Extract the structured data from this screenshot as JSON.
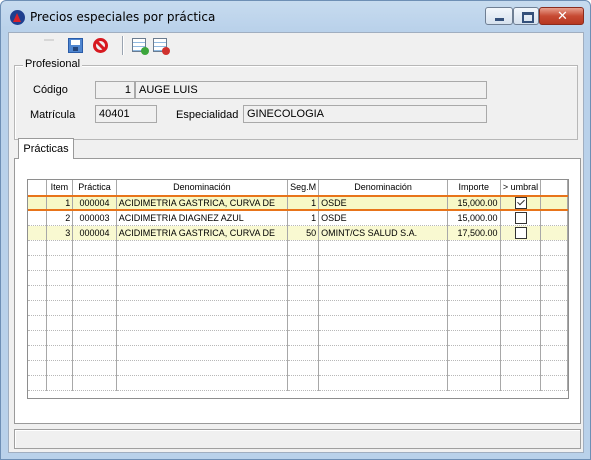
{
  "window": {
    "title": "Precios especiales por práctica"
  },
  "toolbar": {
    "icons": [
      "new-icon",
      "save-icon",
      "cancel-icon",
      "add-row-icon",
      "delete-row-icon"
    ]
  },
  "profesional": {
    "legend": "Profesional",
    "codigo_label": "Código",
    "codigo_num": "1",
    "nombre": "AUGE LUIS",
    "matricula_label": "Matrícula",
    "matricula": "40401",
    "especialidad_label": "Especialidad",
    "especialidad": "GINECOLOGIA"
  },
  "tabs": [
    {
      "label": "Prácticas"
    }
  ],
  "grid": {
    "columns": [
      "Item",
      "Práctica",
      "Denominación",
      "Seg.M",
      "Denominación",
      "Importe",
      "> umbral"
    ],
    "rows": [
      {
        "item": "1",
        "practica": "000004",
        "denominacion": "ACIDIMETRIA GASTRICA, CURVA DE",
        "seg": "1",
        "os": "OSDE",
        "importe": "15,000.00",
        "umbral": true
      },
      {
        "item": "2",
        "practica": "000003",
        "denominacion": "ACIDIMETRIA DIAGNEZ AZUL",
        "seg": "1",
        "os": "OSDE",
        "importe": "15,000.00",
        "umbral": false
      },
      {
        "item": "3",
        "practica": "000004",
        "denominacion": "ACIDIMETRIA GASTRICA, CURVA DE",
        "seg": "50",
        "os": "OMINT/CS SALUD S.A.",
        "importe": "17,500.00",
        "umbral": false
      }
    ],
    "selected_row": 1,
    "colors": {
      "selection": "#e8741a",
      "row_highlight": "#f9f9d1"
    }
  }
}
